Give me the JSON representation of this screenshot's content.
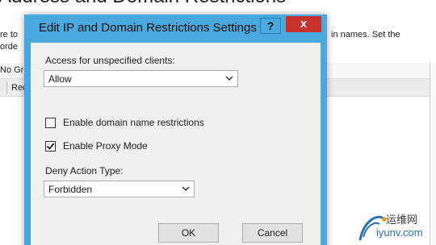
{
  "background": {
    "page_title": "Address and Domain Restrictions",
    "line1_left": "re to",
    "line1_right": "in names. Set the",
    "line2_left": "orde",
    "table_header": "No Gro",
    "table_row": "Rec"
  },
  "dialog": {
    "title": "Edit IP and Domain Restrictions Settings",
    "help_label": "?",
    "close_label": "x",
    "access_label": "Access for unspecified clients:",
    "access_value": "Allow",
    "domain_restrictions_label": "Enable domain name restrictions",
    "domain_restrictions_checked": false,
    "proxy_mode_label": "Enable Proxy Mode",
    "proxy_mode_checked": true,
    "deny_action_label": "Deny Action Type:",
    "deny_action_value": "Forbidden",
    "ok_label": "OK",
    "cancel_label": "Cancel"
  },
  "watermark": {
    "cn": "运维网",
    "en": "iyunv.com"
  },
  "colors": {
    "title_bar": "#49a9dc",
    "close_button": "#c7302b",
    "dialog_body": "#f0f0f0"
  }
}
